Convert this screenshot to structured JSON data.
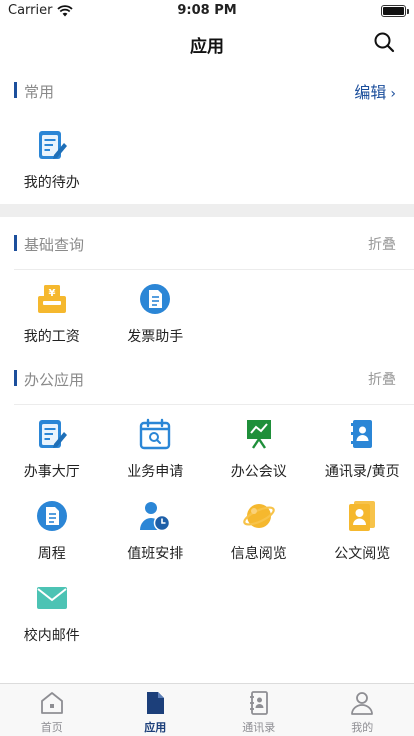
{
  "status_bar": {
    "carrier": "Carrier",
    "time": "9:08 PM"
  },
  "nav": {
    "title": "应用"
  },
  "sections": {
    "common": {
      "title": "常用",
      "action": "编辑",
      "items": [
        {
          "label": "我的待办",
          "icon": "todo-doc-icon"
        }
      ]
    },
    "basic": {
      "title": "基础查询",
      "action": "折叠",
      "items": [
        {
          "label": "我的工资",
          "icon": "salary-icon"
        },
        {
          "label": "发票助手",
          "icon": "invoice-icon"
        }
      ]
    },
    "office": {
      "title": "办公应用",
      "action": "折叠",
      "items": [
        {
          "label": "办事大厅",
          "icon": "service-hall-icon"
        },
        {
          "label": "业务申请",
          "icon": "calendar-search-icon"
        },
        {
          "label": "办公会议",
          "icon": "meeting-board-icon"
        },
        {
          "label": "通讯录/黄页",
          "icon": "contacts-book-icon"
        },
        {
          "label": "周程",
          "icon": "weekly-doc-icon"
        },
        {
          "label": "值班安排",
          "icon": "duty-person-clock-icon"
        },
        {
          "label": "信息阅览",
          "icon": "planet-icon"
        },
        {
          "label": "公文阅览",
          "icon": "official-doc-icon"
        },
        {
          "label": "校内邮件",
          "icon": "mail-envelope-icon"
        }
      ]
    }
  },
  "tab_bar": {
    "items": [
      {
        "label": "首页",
        "icon": "home-icon"
      },
      {
        "label": "应用",
        "icon": "app-doc-icon",
        "active": true
      },
      {
        "label": "通讯录",
        "icon": "address-book-icon"
      },
      {
        "label": "我的",
        "icon": "user-icon"
      }
    ]
  },
  "colors": {
    "accent": "#1c4f9c",
    "tab_active": "#1c3f7a",
    "icon_blue": "#2b86d6",
    "icon_yellow": "#f5b82e",
    "icon_green": "#1f8f3a",
    "icon_teal": "#4cc3b4"
  }
}
